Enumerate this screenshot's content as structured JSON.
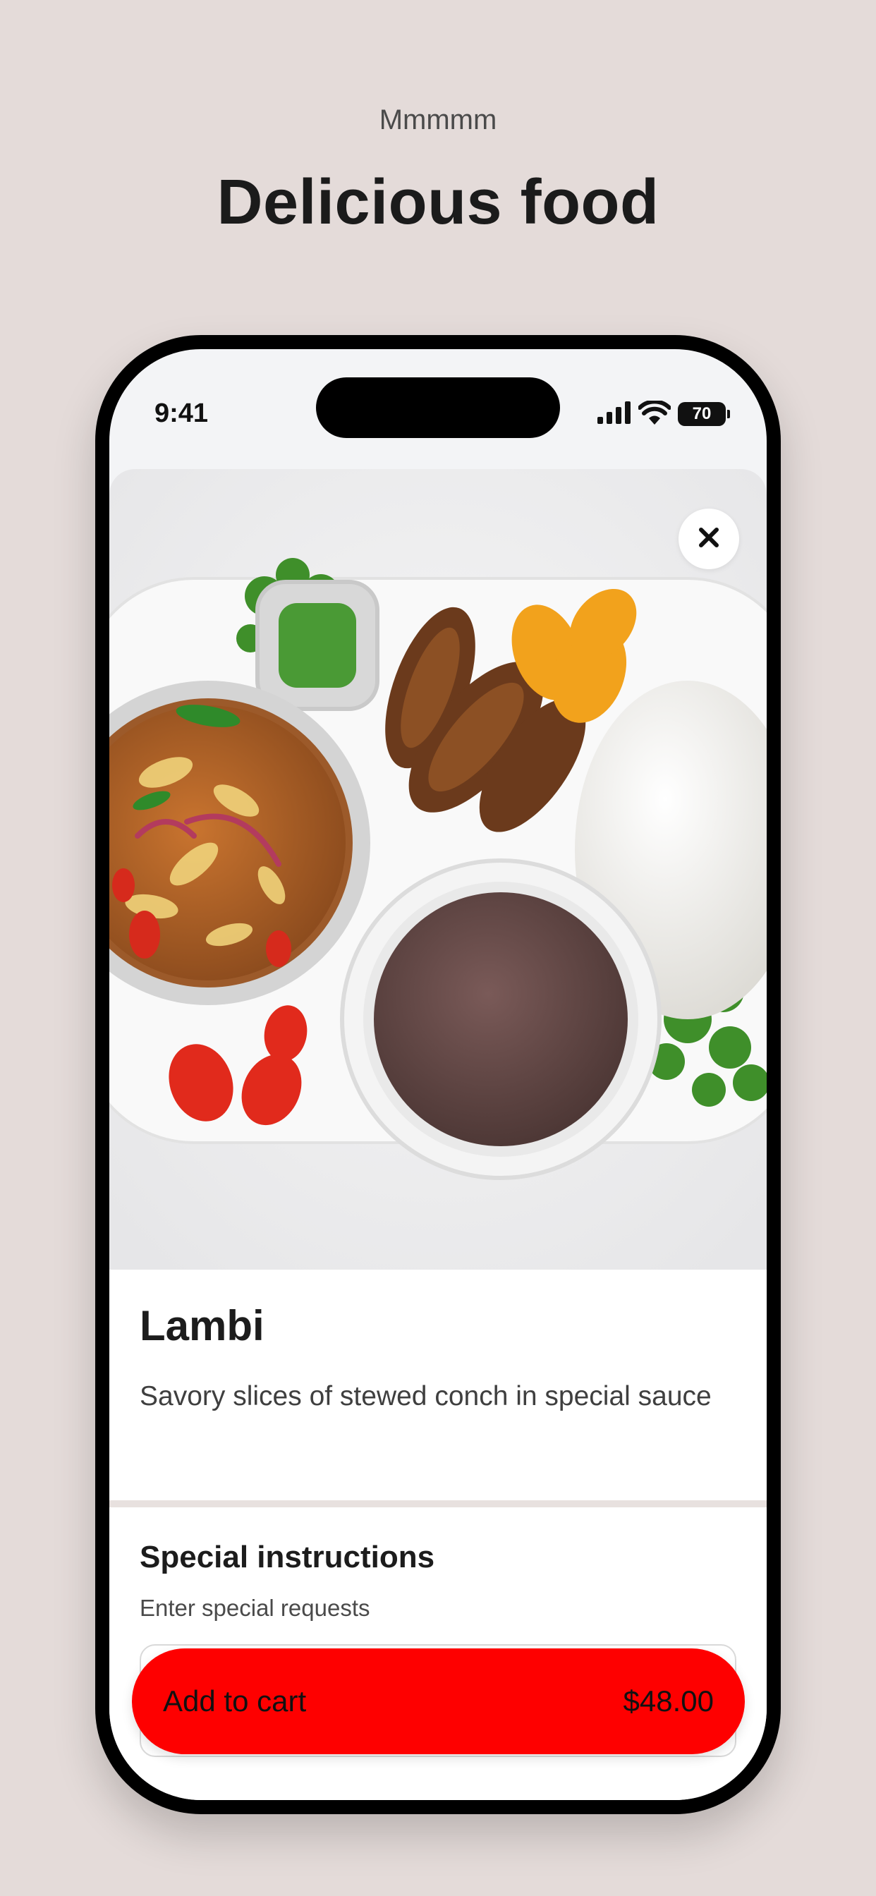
{
  "header": {
    "eyebrow": "Mmmmm",
    "title": "Delicious food"
  },
  "status_bar": {
    "time": "9:41",
    "battery": "70"
  },
  "item": {
    "name": "Lambi",
    "description": "Savory slices of stewed conch in special sauce",
    "image_alt": "Plate of stewed conch with plantains, rice, bean sauce and peppers"
  },
  "instructions": {
    "title": "Special instructions",
    "subtitle": "Enter special requests"
  },
  "cart_button": {
    "label": "Add to cart",
    "price": "$48.00"
  },
  "colors": {
    "background": "#e4dbd9",
    "cta": "#fe0000"
  },
  "icons": {
    "close": "close-icon",
    "signal": "signal-icon",
    "wifi": "wifi-icon",
    "battery": "battery-icon"
  }
}
